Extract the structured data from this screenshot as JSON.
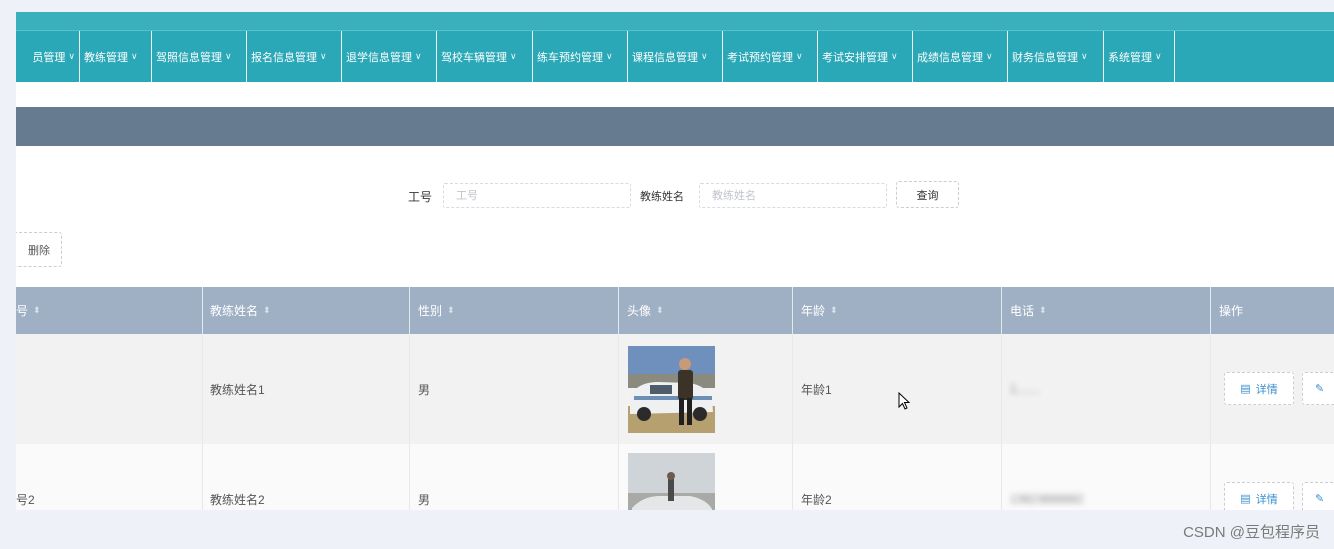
{
  "nav": {
    "items": [
      {
        "label": "员管理"
      },
      {
        "label": "教练管理"
      },
      {
        "label": "驾照信息管理"
      },
      {
        "label": "报名信息管理"
      },
      {
        "label": "退学信息管理"
      },
      {
        "label": "驾校车辆管理"
      },
      {
        "label": "练车预约管理"
      },
      {
        "label": "课程信息管理"
      },
      {
        "label": "考试预约管理"
      },
      {
        "label": "考试安排管理"
      },
      {
        "label": "成绩信息管理"
      },
      {
        "label": "财务信息管理"
      },
      {
        "label": "系统管理"
      }
    ]
  },
  "search": {
    "id_label": "工号",
    "id_placeholder": "工号",
    "name_label": "教练姓名",
    "name_placeholder": "教练姓名",
    "query_button": "查询"
  },
  "toolbar": {
    "delete_button": "删除"
  },
  "table": {
    "columns": [
      "号",
      "教练姓名",
      "性别",
      "头像",
      "年龄",
      "电话",
      "操作"
    ],
    "rows": [
      {
        "id": "",
        "name": "教练姓名1",
        "gender": "男",
        "age": "年龄1",
        "phone": "1.......",
        "detail": "详情"
      },
      {
        "id": "号2",
        "name": "教练姓名2",
        "gender": "男",
        "age": "年龄2",
        "phone": "13823888882",
        "detail": "详情"
      }
    ]
  },
  "watermark": "CSDN @豆包程序员"
}
